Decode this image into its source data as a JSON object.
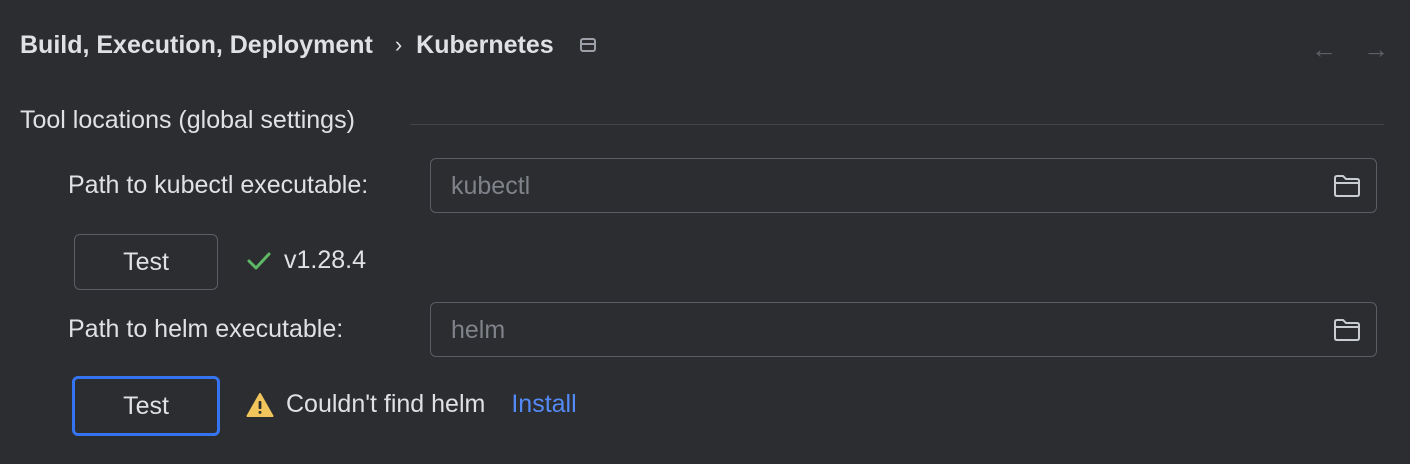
{
  "header": {
    "breadcrumb_parent": "Build, Execution, Deployment",
    "breadcrumb_separator": "›",
    "breadcrumb_current": "Kubernetes",
    "back_arrow": "←",
    "forward_arrow": "→"
  },
  "section": {
    "title": "Tool locations (global settings)"
  },
  "kubectl": {
    "label": "Path to kubectl executable:",
    "placeholder": "kubectl",
    "test_label": "Test",
    "status_text": "v1.28.4",
    "status_icon": "checkmark-icon",
    "status_color": "#5fb865"
  },
  "helm": {
    "label": "Path to helm executable:",
    "placeholder": "helm",
    "test_label": "Test",
    "status_text": "Couldn't find helm",
    "status_icon": "warning-icon",
    "status_color": "#f2c55c",
    "install_label": "Install"
  },
  "colors": {
    "background": "#2b2d30",
    "accent": "#3574f0",
    "link": "#548af7"
  }
}
